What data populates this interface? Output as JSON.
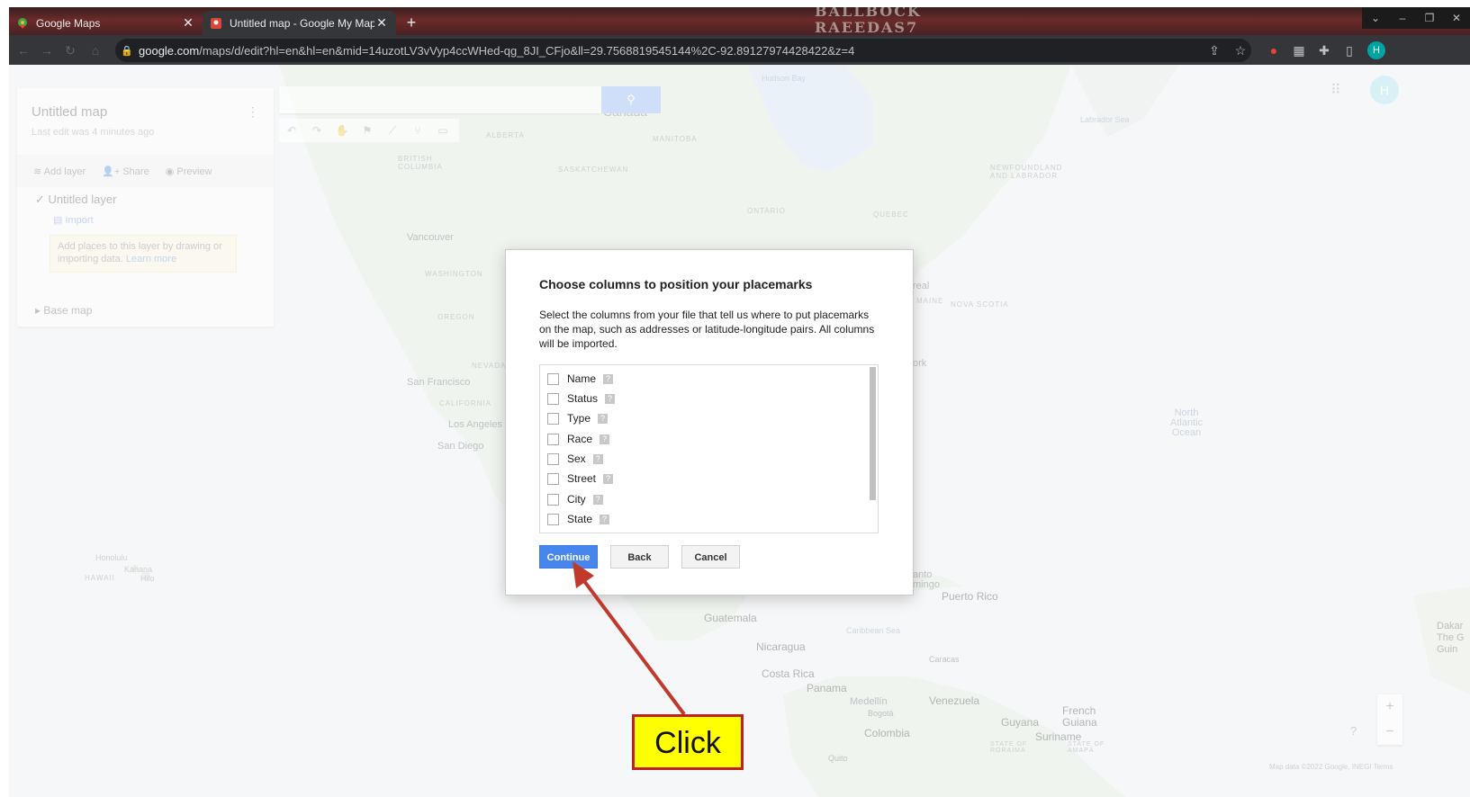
{
  "browser": {
    "tabs": [
      {
        "title": "Google Maps",
        "active": false
      },
      {
        "title": "Untitled map - Google My Maps",
        "active": true
      }
    ],
    "url_host": "google.com",
    "url_path": "/maps/d/edit?hl=en&hl=en&mid=14uzotLV3vVyp4ccWHed-qg_8JI_CFjo&ll=29.7568819545144%2C-92.89127974428422&z=4",
    "profile_initial": "H",
    "watermark": "BALLBOCK RAEEDAS7"
  },
  "map_panel": {
    "title": "Untitled map",
    "subtitle": "Last edit was 4 minutes ago",
    "add_layer": "Add layer",
    "share": "Share",
    "preview": "Preview",
    "layer_name": "Untitled layer",
    "import": "Import",
    "note": "Add places to this layer by drawing or importing data.",
    "learn_more": "Learn more",
    "base_map": "Base map"
  },
  "map_labels": {
    "canada": "Canada",
    "hudson_bay": "Hudson Bay",
    "labrador_sea": "Labrador Sea",
    "alberta": "ALBERTA",
    "manitoba": "MANITOBA",
    "british_columbia": "BRITISH\nCOLUMBIA",
    "saskatchewan": "SASKATCHEWAN",
    "ontario": "ONTARIO",
    "quebec": "QUEBEC",
    "newfoundland": "NEWFOUNDLAND\nAND LABRADOR",
    "vancouver": "Vancouver",
    "washington": "WASHINGTON",
    "oregon": "OREGON",
    "nevada": "NEVADA",
    "san_francisco": "San Francisco",
    "california": "CALIFORNIA",
    "los_angeles": "Los Angeles",
    "san_diego": "San Diego",
    "honolulu": "Honolulu",
    "hawaii": "HAWAII",
    "kahana": "Kahana",
    "hilo": "Hilo",
    "real": "real",
    "maine": "MAINE",
    "nova_scotia": "NOVA SCOTIA",
    "york": "ork",
    "north_atlantic": "North\nAtlantic\nOcean",
    "santo_domingo": "anto\nmingo",
    "puerto_rico": "Puerto Rico",
    "guatemala": "Guatemala",
    "caribbean_sea": "Caribbean Sea",
    "nicaragua": "Nicaragua",
    "caracas": "Caracas",
    "costa_rica": "Costa Rica",
    "panama": "Panama",
    "medellin": "Medellín",
    "venezuela": "Venezuela",
    "bogota": "Bogotá",
    "guyana": "Guyana",
    "french_guiana": "French\nGuiana",
    "suriname": "Suriname",
    "colombia": "Colombia",
    "quito": "Quito",
    "dakar": "Dakar\nThe G\nGuin",
    "attribution": "Map data ©2022 Google, INEGI   Terms",
    "state_of_roraima": "STATE OF\nRORAIMA",
    "state_of_amapa": "STATE OF\nAMAPÁ"
  },
  "dialog": {
    "title": "Choose columns to position your placemarks",
    "description": "Select the columns from your file that tell us where to put placemarks on the map, such as addresses or latitude-longitude pairs. All columns will be imported.",
    "columns": [
      {
        "label": "Name",
        "checked": false
      },
      {
        "label": "Status",
        "checked": false
      },
      {
        "label": "Type",
        "checked": false
      },
      {
        "label": "Race",
        "checked": false
      },
      {
        "label": "Sex",
        "checked": false
      },
      {
        "label": "Street",
        "checked": false
      },
      {
        "label": "City",
        "checked": false
      },
      {
        "label": "State",
        "checked": false
      }
    ],
    "continue": "Continue",
    "back": "Back",
    "cancel": "Cancel"
  },
  "annotation": {
    "label": "Click",
    "color_box": "#ffff00",
    "color_arrow": "#c0392b"
  },
  "colors": {
    "accent": "#4787ed",
    "browser_dark": "#35363a"
  }
}
